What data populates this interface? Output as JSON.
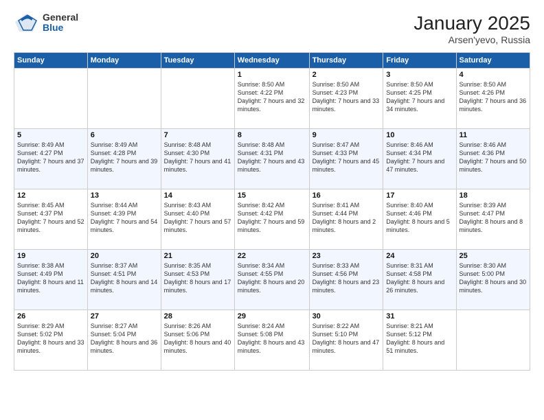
{
  "header": {
    "logo": {
      "general": "General",
      "blue": "Blue"
    },
    "title": "January 2025",
    "location": "Arsen'yevo, Russia"
  },
  "weekdays": [
    "Sunday",
    "Monday",
    "Tuesday",
    "Wednesday",
    "Thursday",
    "Friday",
    "Saturday"
  ],
  "weeks": [
    [
      {
        "day": "",
        "sunrise": "",
        "sunset": "",
        "daylight": ""
      },
      {
        "day": "",
        "sunrise": "",
        "sunset": "",
        "daylight": ""
      },
      {
        "day": "",
        "sunrise": "",
        "sunset": "",
        "daylight": ""
      },
      {
        "day": "1",
        "sunrise": "Sunrise: 8:50 AM",
        "sunset": "Sunset: 4:22 PM",
        "daylight": "Daylight: 7 hours and 32 minutes."
      },
      {
        "day": "2",
        "sunrise": "Sunrise: 8:50 AM",
        "sunset": "Sunset: 4:23 PM",
        "daylight": "Daylight: 7 hours and 33 minutes."
      },
      {
        "day": "3",
        "sunrise": "Sunrise: 8:50 AM",
        "sunset": "Sunset: 4:25 PM",
        "daylight": "Daylight: 7 hours and 34 minutes."
      },
      {
        "day": "4",
        "sunrise": "Sunrise: 8:50 AM",
        "sunset": "Sunset: 4:26 PM",
        "daylight": "Daylight: 7 hours and 36 minutes."
      }
    ],
    [
      {
        "day": "5",
        "sunrise": "Sunrise: 8:49 AM",
        "sunset": "Sunset: 4:27 PM",
        "daylight": "Daylight: 7 hours and 37 minutes."
      },
      {
        "day": "6",
        "sunrise": "Sunrise: 8:49 AM",
        "sunset": "Sunset: 4:28 PM",
        "daylight": "Daylight: 7 hours and 39 minutes."
      },
      {
        "day": "7",
        "sunrise": "Sunrise: 8:48 AM",
        "sunset": "Sunset: 4:30 PM",
        "daylight": "Daylight: 7 hours and 41 minutes."
      },
      {
        "day": "8",
        "sunrise": "Sunrise: 8:48 AM",
        "sunset": "Sunset: 4:31 PM",
        "daylight": "Daylight: 7 hours and 43 minutes."
      },
      {
        "day": "9",
        "sunrise": "Sunrise: 8:47 AM",
        "sunset": "Sunset: 4:33 PM",
        "daylight": "Daylight: 7 hours and 45 minutes."
      },
      {
        "day": "10",
        "sunrise": "Sunrise: 8:46 AM",
        "sunset": "Sunset: 4:34 PM",
        "daylight": "Daylight: 7 hours and 47 minutes."
      },
      {
        "day": "11",
        "sunrise": "Sunrise: 8:46 AM",
        "sunset": "Sunset: 4:36 PM",
        "daylight": "Daylight: 7 hours and 50 minutes."
      }
    ],
    [
      {
        "day": "12",
        "sunrise": "Sunrise: 8:45 AM",
        "sunset": "Sunset: 4:37 PM",
        "daylight": "Daylight: 7 hours and 52 minutes."
      },
      {
        "day": "13",
        "sunrise": "Sunrise: 8:44 AM",
        "sunset": "Sunset: 4:39 PM",
        "daylight": "Daylight: 7 hours and 54 minutes."
      },
      {
        "day": "14",
        "sunrise": "Sunrise: 8:43 AM",
        "sunset": "Sunset: 4:40 PM",
        "daylight": "Daylight: 7 hours and 57 minutes."
      },
      {
        "day": "15",
        "sunrise": "Sunrise: 8:42 AM",
        "sunset": "Sunset: 4:42 PM",
        "daylight": "Daylight: 7 hours and 59 minutes."
      },
      {
        "day": "16",
        "sunrise": "Sunrise: 8:41 AM",
        "sunset": "Sunset: 4:44 PM",
        "daylight": "Daylight: 8 hours and 2 minutes."
      },
      {
        "day": "17",
        "sunrise": "Sunrise: 8:40 AM",
        "sunset": "Sunset: 4:46 PM",
        "daylight": "Daylight: 8 hours and 5 minutes."
      },
      {
        "day": "18",
        "sunrise": "Sunrise: 8:39 AM",
        "sunset": "Sunset: 4:47 PM",
        "daylight": "Daylight: 8 hours and 8 minutes."
      }
    ],
    [
      {
        "day": "19",
        "sunrise": "Sunrise: 8:38 AM",
        "sunset": "Sunset: 4:49 PM",
        "daylight": "Daylight: 8 hours and 11 minutes."
      },
      {
        "day": "20",
        "sunrise": "Sunrise: 8:37 AM",
        "sunset": "Sunset: 4:51 PM",
        "daylight": "Daylight: 8 hours and 14 minutes."
      },
      {
        "day": "21",
        "sunrise": "Sunrise: 8:35 AM",
        "sunset": "Sunset: 4:53 PM",
        "daylight": "Daylight: 8 hours and 17 minutes."
      },
      {
        "day": "22",
        "sunrise": "Sunrise: 8:34 AM",
        "sunset": "Sunset: 4:55 PM",
        "daylight": "Daylight: 8 hours and 20 minutes."
      },
      {
        "day": "23",
        "sunrise": "Sunrise: 8:33 AM",
        "sunset": "Sunset: 4:56 PM",
        "daylight": "Daylight: 8 hours and 23 minutes."
      },
      {
        "day": "24",
        "sunrise": "Sunrise: 8:31 AM",
        "sunset": "Sunset: 4:58 PM",
        "daylight": "Daylight: 8 hours and 26 minutes."
      },
      {
        "day": "25",
        "sunrise": "Sunrise: 8:30 AM",
        "sunset": "Sunset: 5:00 PM",
        "daylight": "Daylight: 8 hours and 30 minutes."
      }
    ],
    [
      {
        "day": "26",
        "sunrise": "Sunrise: 8:29 AM",
        "sunset": "Sunset: 5:02 PM",
        "daylight": "Daylight: 8 hours and 33 minutes."
      },
      {
        "day": "27",
        "sunrise": "Sunrise: 8:27 AM",
        "sunset": "Sunset: 5:04 PM",
        "daylight": "Daylight: 8 hours and 36 minutes."
      },
      {
        "day": "28",
        "sunrise": "Sunrise: 8:26 AM",
        "sunset": "Sunset: 5:06 PM",
        "daylight": "Daylight: 8 hours and 40 minutes."
      },
      {
        "day": "29",
        "sunrise": "Sunrise: 8:24 AM",
        "sunset": "Sunset: 5:08 PM",
        "daylight": "Daylight: 8 hours and 43 minutes."
      },
      {
        "day": "30",
        "sunrise": "Sunrise: 8:22 AM",
        "sunset": "Sunset: 5:10 PM",
        "daylight": "Daylight: 8 hours and 47 minutes."
      },
      {
        "day": "31",
        "sunrise": "Sunrise: 8:21 AM",
        "sunset": "Sunset: 5:12 PM",
        "daylight": "Daylight: 8 hours and 51 minutes."
      },
      {
        "day": "",
        "sunrise": "",
        "sunset": "",
        "daylight": ""
      }
    ]
  ]
}
